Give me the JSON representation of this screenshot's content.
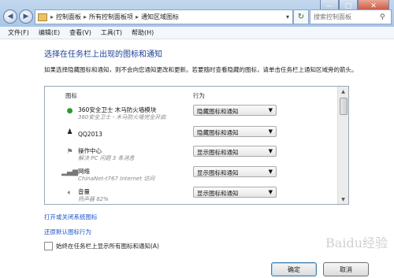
{
  "window": {
    "minimize": "—",
    "maximize": "□",
    "close": "✕"
  },
  "nav": {
    "back": "◀",
    "forward": "▶"
  },
  "address": {
    "crumbs": [
      "控制面板",
      "所有控制面板项",
      "通知区域图标"
    ],
    "separator": "▸"
  },
  "search": {
    "placeholder": "搜索控制面板"
  },
  "menu": [
    "文件(F)",
    "编辑(E)",
    "查看(V)",
    "工具(T)",
    "帮助(H)"
  ],
  "page": {
    "heading": "选择在任务栏上出现的图标和通知",
    "description": "如果选择隐藏图标和通知，则不会向您通知更改和更新。若要随时查看隐藏的图标，请单击任务栏上通知区域旁的箭头。",
    "col_icon": "图标",
    "col_behavior": "行为"
  },
  "rows": [
    {
      "icon": "360-shield-icon",
      "name": "360安全卫士 木马防火墙模块",
      "sub": "360安全卫士 - 木马防火墙完全开启",
      "behavior": "隐藏图标和通知"
    },
    {
      "icon": "qq-penguin-icon",
      "name": "QQ2013",
      "sub": "",
      "behavior": "隐藏图标和通知"
    },
    {
      "icon": "flag-icon",
      "name": "操作中心",
      "sub": "解决 PC 问题 3 条消息",
      "behavior": "显示图标和通知"
    },
    {
      "icon": "network-icon",
      "name": "网络",
      "sub": "ChinaNet-t767 Internet 访问",
      "behavior": "显示图标和通知"
    },
    {
      "icon": "speaker-icon",
      "name": "音量",
      "sub": "扬声器 82%",
      "behavior": "显示图标和通知"
    }
  ],
  "links": {
    "system_icons": "打开或关闭系统图标",
    "restore": "还原默认图标行为"
  },
  "checkbox": {
    "label": "始终在任务栏上显示所有图标和通知(A)"
  },
  "buttons": {
    "ok": "确定",
    "cancel": "取消"
  },
  "watermark": "Baidu经验"
}
